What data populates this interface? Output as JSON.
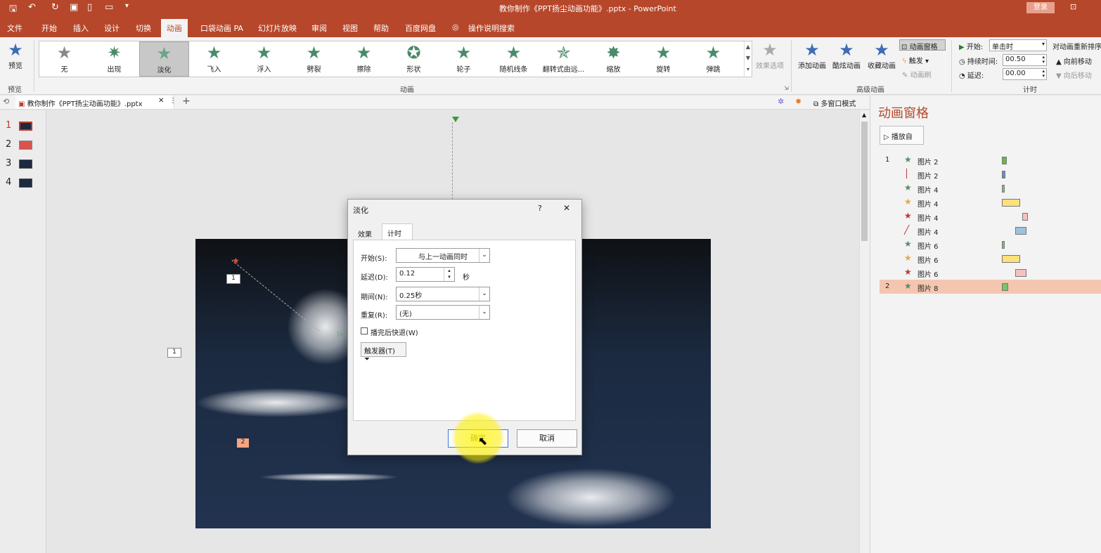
{
  "titlebar": {
    "title": "教你制作《PPT扬尘动画功能》.pptx  -  PowerPoint",
    "login": "登录"
  },
  "menu": [
    "文件",
    "开始",
    "插入",
    "设计",
    "切换",
    "动画",
    "口袋动画 PA",
    "幻灯片放映",
    "审阅",
    "视图",
    "帮助",
    "百度网盘",
    "操作说明搜索"
  ],
  "ribbon": {
    "preview": "预览",
    "preview_group": "预览",
    "gallery": [
      "无",
      "出现",
      "淡化",
      "飞入",
      "浮入",
      "劈裂",
      "擦除",
      "形状",
      "轮子",
      "随机线条",
      "翻转式由远...",
      "缩放",
      "旋转",
      "弹跳"
    ],
    "effect_options": "效果选项",
    "anim_group": "动画",
    "add_anim": "添加动画",
    "cool_anim": "酷炫动画",
    "fav_anim": "收藏动画",
    "anim_pane": "动画窗格",
    "trigger": "触发",
    "anim_brush": "动画刷",
    "adv_group": "高级动画",
    "start_label": "开始:",
    "start_value": "单击时",
    "duration_label": "持续时间:",
    "duration_value": "00.50",
    "delay_label": "延迟:",
    "delay_value": "00.00",
    "timing_group": "计时",
    "reorder": "对动画重新排序",
    "move_earlier": "向前移动",
    "move_later": "向后移动"
  },
  "doc_tab": {
    "label": "教你制作《PPT扬尘动画功能》.pptx",
    "multiwin": "多窗口模式"
  },
  "thumbs": [
    "1",
    "2",
    "3",
    "4"
  ],
  "slide": {
    "tag1": "1",
    "tag2": "2",
    "tag_side": "1"
  },
  "anim_pane": {
    "title": "动画窗格",
    "play": "播放自",
    "rows": [
      {
        "num": "1",
        "name": "图片 2",
        "color": "#5a8a6a",
        "bar": "#66bb44"
      },
      {
        "num": "",
        "name": "图片 2",
        "color": "#b03030",
        "bar": "#6a8cc8"
      },
      {
        "num": "",
        "name": "图片 4",
        "color": "#5a8a6a",
        "bar": "#7cc36a"
      },
      {
        "num": "",
        "name": "图片 4",
        "color": "#e3a93a",
        "bar": "#ffe17a"
      },
      {
        "num": "",
        "name": "图片 4",
        "color": "#c0392b",
        "bar": "#f8c0c0"
      },
      {
        "num": "",
        "name": "图片 4",
        "color": "#b03030",
        "bar": "#9cc2dc"
      },
      {
        "num": "",
        "name": "图片 6",
        "color": "#5a8a6a",
        "bar": "#7cc36a"
      },
      {
        "num": "",
        "name": "图片 6",
        "color": "#e3a93a",
        "bar": "#ffe17a"
      },
      {
        "num": "",
        "name": "图片 6",
        "color": "#c0392b",
        "bar": "#f8c0c0"
      },
      {
        "num": "2",
        "name": "图片 8",
        "color": "#5a8a6a",
        "bar": "#7cc36a"
      }
    ]
  },
  "dialog": {
    "title": "淡化",
    "help": "?",
    "close": "✕",
    "tab_effect": "效果",
    "tab_timing": "计时",
    "start_label": "开始(S):",
    "start_value": "与上一动画同时",
    "delay_label": "延迟(D):",
    "delay_value": "0.12",
    "delay_unit": "秒",
    "duration_label": "期间(N):",
    "duration_value": "0.25秒",
    "repeat_label": "重复(R):",
    "repeat_value": "(无)",
    "rewind_label": "播完后快退(W)",
    "trigger_label": "触发器(T)",
    "ok": "确定",
    "cancel": "取消"
  }
}
